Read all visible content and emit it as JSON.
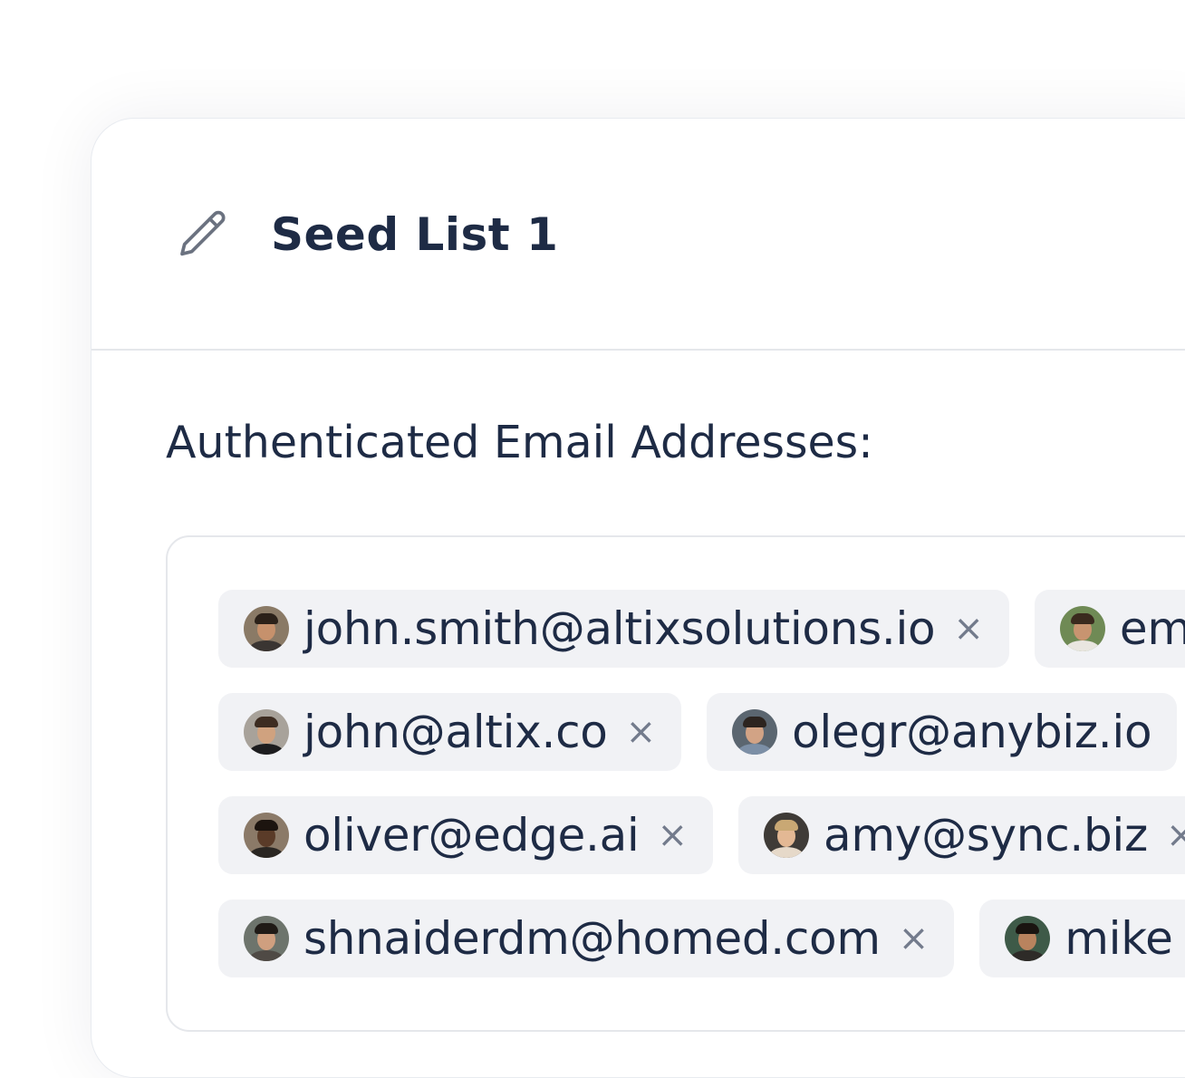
{
  "card": {
    "title": "Seed List 1",
    "edit_icon": "pencil-icon"
  },
  "section": {
    "label": "Authenticated Email Addresses:"
  },
  "emails": [
    {
      "address": "john.smith@altixsolutions.io",
      "remove": "×",
      "avatar": {
        "bg": "#8a7a66",
        "skin": "#c6916c",
        "hair": "#2b2119",
        "shirt": "#3a3532"
      }
    },
    {
      "address": "em",
      "remove": "",
      "avatar": {
        "bg": "#6f8a55",
        "skin": "#c89470",
        "hair": "#3a2a1e",
        "shirt": "#e9e6e0"
      }
    },
    {
      "address": "john@altix.co",
      "remove": "×",
      "avatar": {
        "bg": "#a8a29a",
        "skin": "#d0a27f",
        "hair": "#3d2c21",
        "shirt": "#1d1d1f"
      }
    },
    {
      "address": "olegr@anybiz.io",
      "remove": "",
      "avatar": {
        "bg": "#5b6670",
        "skin": "#d2a385",
        "hair": "#2c241f",
        "shirt": "#7c8fa6"
      }
    },
    {
      "address": "oliver@edge.ai",
      "remove": "×",
      "avatar": {
        "bg": "#8b7a68",
        "skin": "#5a3b28",
        "hair": "#1c140f",
        "shirt": "#2a2622"
      }
    },
    {
      "address": "amy@sync.biz",
      "remove": "×",
      "avatar": {
        "bg": "#3f3b37",
        "skin": "#e3b894",
        "hair": "#c9a874",
        "shirt": "#e6d9c9"
      }
    },
    {
      "address": "shnaiderdm@homed.com",
      "remove": "×",
      "avatar": {
        "bg": "#6d746c",
        "skin": "#cf9f7f",
        "hair": "#1f1a16",
        "shirt": "#4f4a45"
      }
    },
    {
      "address": "mike",
      "remove": "",
      "avatar": {
        "bg": "#3e5a48",
        "skin": "#b9835e",
        "hair": "#1a1410",
        "shirt": "#2e2b28"
      }
    }
  ]
}
